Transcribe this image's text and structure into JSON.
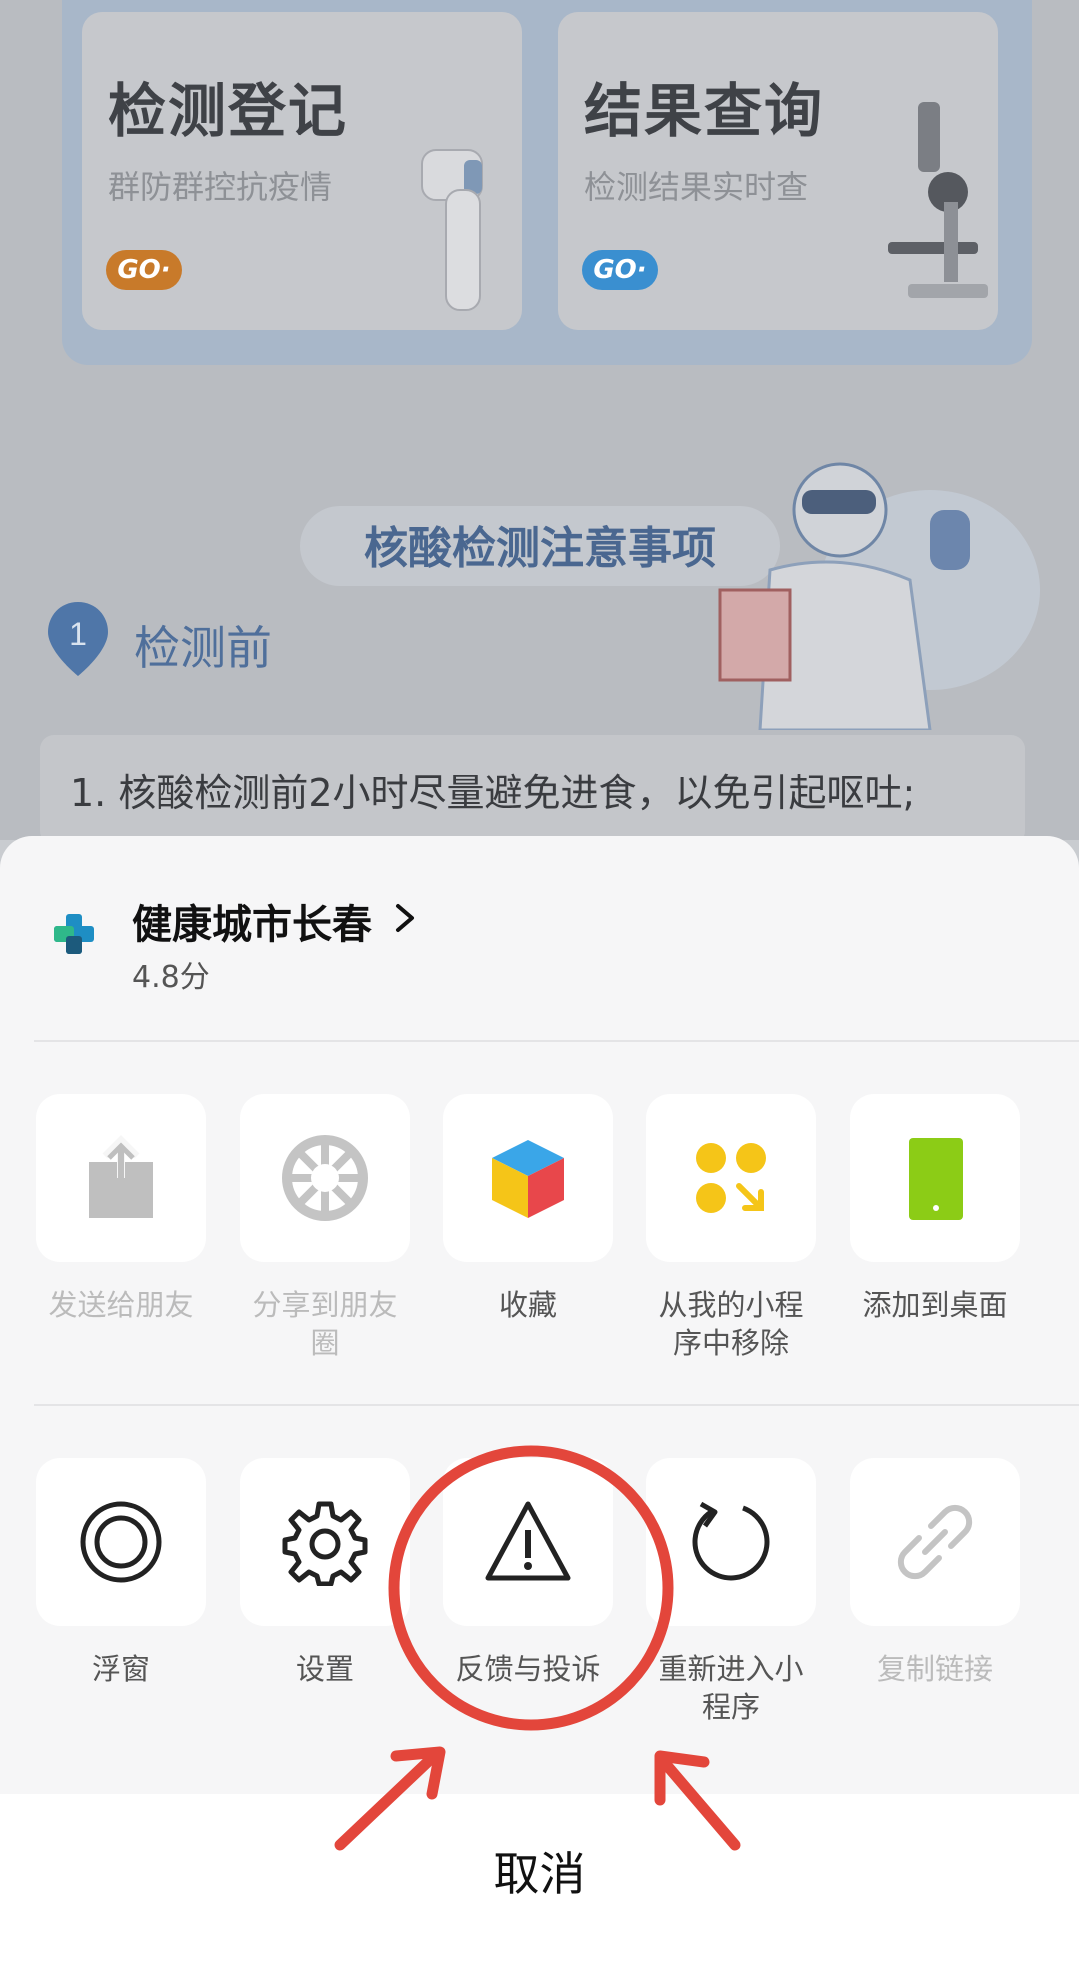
{
  "background": {
    "cards": [
      {
        "title": "检测登记",
        "subtitle": "群防群控抗疫情",
        "go": "GO·",
        "go_color": "#c87a2a"
      },
      {
        "title": "结果查询",
        "subtitle": "检测结果实时查",
        "go": "GO·",
        "go_color": "#3a8fd0"
      }
    ],
    "notice_title": "核酸检测注意事项",
    "step_number": "1",
    "step_label": "检测前",
    "rule_text": "1. 核酸检测前2小时尽量避免进食，以免引起呕吐;"
  },
  "sheet": {
    "app_name": "健康城市长春",
    "rating": "4.8分",
    "row1": [
      {
        "icon": "share-icon",
        "label": "发送给朋友",
        "enabled": false
      },
      {
        "icon": "moments-icon",
        "label": "分享到朋友圈",
        "enabled": false
      },
      {
        "icon": "favorite-cube-icon",
        "label": "收藏",
        "enabled": true
      },
      {
        "icon": "remove-miniprogram-icon",
        "label": "从我的小程序中移除",
        "enabled": true
      },
      {
        "icon": "add-to-desktop-icon",
        "label": "添加到桌面",
        "enabled": true
      }
    ],
    "row2": [
      {
        "icon": "float-window-icon",
        "label": "浮窗",
        "enabled": true
      },
      {
        "icon": "settings-icon",
        "label": "设置",
        "enabled": true
      },
      {
        "icon": "warning-icon",
        "label": "反馈与投诉",
        "enabled": true
      },
      {
        "icon": "reload-icon",
        "label": "重新进入小程序",
        "enabled": true
      },
      {
        "icon": "link-icon",
        "label": "复制链接",
        "enabled": false
      }
    ],
    "cancel": "取消"
  },
  "colors": {
    "annotation_red": "#e3463b",
    "green": "#8ccc16",
    "yellow": "#f5c518"
  }
}
